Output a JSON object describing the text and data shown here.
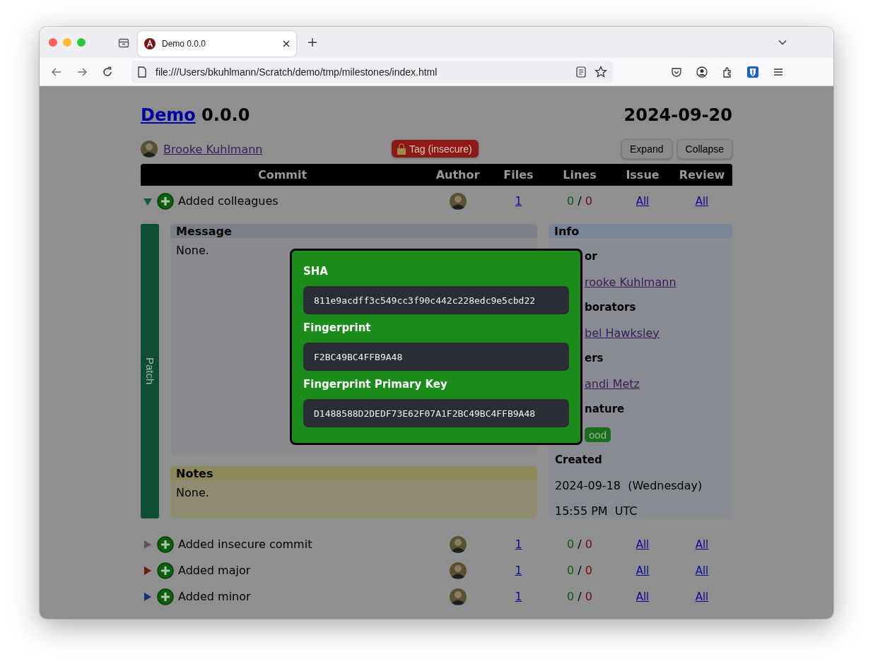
{
  "browser": {
    "tab": {
      "title": "Demo 0.0.0"
    },
    "address": "file:///Users/bkuhlmann/Scratch/demo/tmp/milestones/index.html"
  },
  "header": {
    "project": "Demo",
    "version": "0.0.0",
    "date": "2024-09-20"
  },
  "owner": {
    "name": "Brooke Kuhlmann"
  },
  "tag_badge": {
    "label": "Tag (insecure)"
  },
  "buttons": [
    "Expand",
    "Collapse"
  ],
  "table": {
    "columns": [
      "Commit",
      "Author",
      "Files",
      "Lines",
      "Issue",
      "Review"
    ],
    "rows": [
      {
        "subject": "Added colleagues",
        "expanded": true,
        "color": "#0f5e36",
        "files": "1",
        "added": "0",
        "separator": "/",
        "removed": "0",
        "issue": "All",
        "review": "All"
      },
      {
        "subject": "Added insecure commit",
        "expanded": false,
        "color": "#55585e",
        "files": "1",
        "added": "0",
        "separator": "/",
        "removed": "0",
        "issue": "All",
        "review": "All"
      },
      {
        "subject": "Added major",
        "expanded": false,
        "color": "#6e1a10",
        "files": "1",
        "added": "0",
        "separator": "/",
        "removed": "0",
        "issue": "All",
        "review": "All"
      },
      {
        "subject": "Added minor",
        "expanded": false,
        "color": "#13307a",
        "files": "1",
        "added": "0",
        "separator": "/",
        "removed": "0",
        "issue": "All",
        "review": "All"
      }
    ]
  },
  "detail": {
    "patch_label": "Patch",
    "message": {
      "title": "Message",
      "body": "None."
    },
    "notes": {
      "title": "Notes",
      "body": "None."
    },
    "info": {
      "title": "Info",
      "items": [
        {
          "kind": "label",
          "text": "or"
        },
        {
          "kind": "link",
          "text": "rooke Kuhlmann"
        },
        {
          "kind": "label",
          "text": "borators"
        },
        {
          "kind": "link",
          "text": "bel Hawksley"
        },
        {
          "kind": "label",
          "text": "ers"
        },
        {
          "kind": "link",
          "text": "andi Metz"
        },
        {
          "kind": "label",
          "text": "nature"
        },
        {
          "kind": "badge",
          "text": "ood"
        },
        {
          "kind": "label",
          "text": "Created"
        },
        {
          "kind": "text",
          "text": "2024-09-18  (Wednesday)"
        },
        {
          "kind": "text",
          "text": "15:55 PM  UTC"
        }
      ]
    }
  },
  "modal": {
    "fields": [
      {
        "label": "SHA",
        "value": "811e9acdff3c549cc3f90c442c228edc9e5cbd22"
      },
      {
        "label": "Fingerprint",
        "value": "F2BC49BC4FFB9A48"
      },
      {
        "label": "Fingerprint Primary Key",
        "value": "D1488588D2DEDF73E62F07A1F2BC49BC4FFB9A48"
      }
    ]
  }
}
